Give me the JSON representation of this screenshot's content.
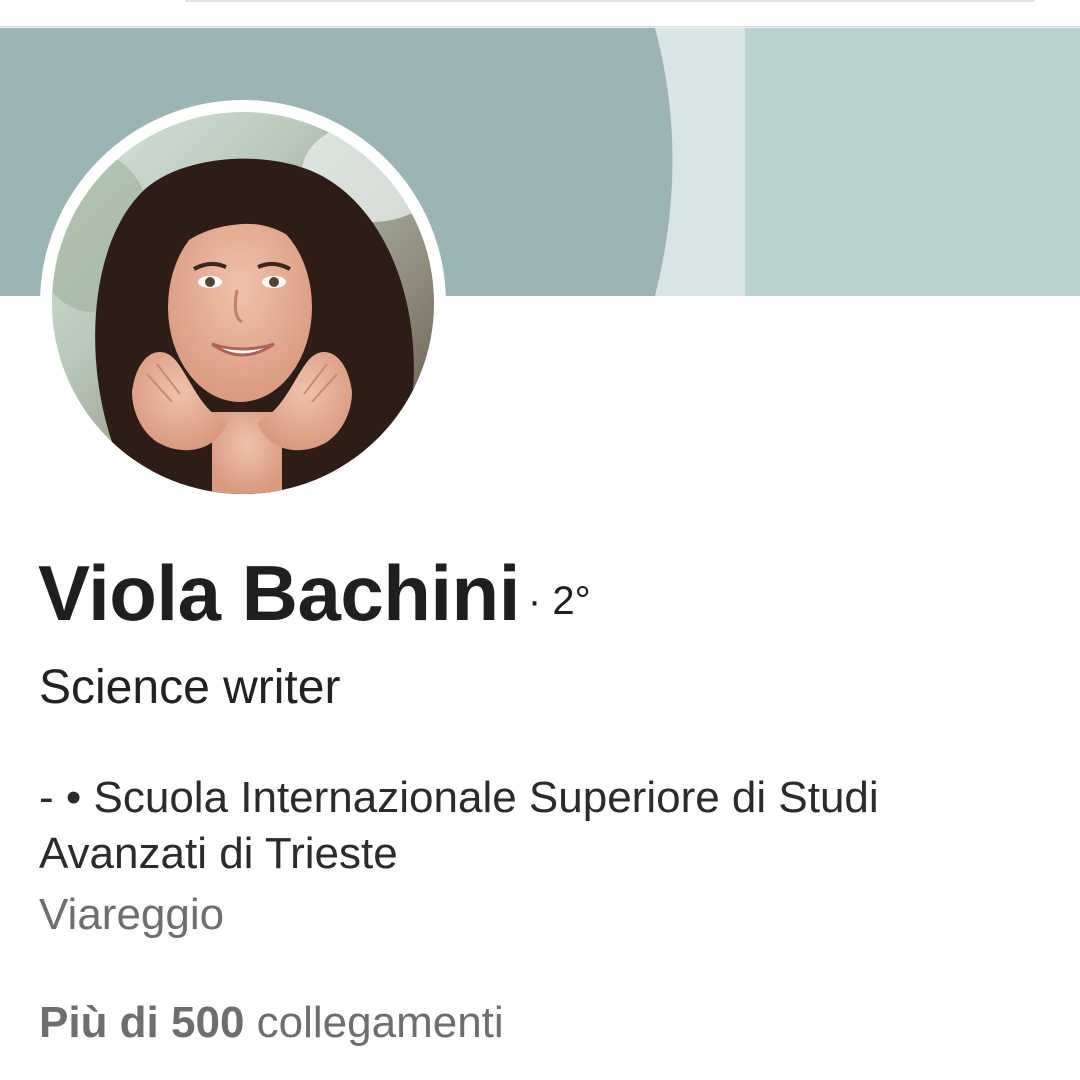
{
  "profile": {
    "name": "Viola Bachini",
    "degree": "· 2°",
    "headline": "Science writer",
    "education": "- • Scuola Internazionale Superiore di Studi Avanzati di Trieste",
    "location": "Viareggio",
    "connections": {
      "count": "Più di 500",
      "label": "collegamenti"
    }
  },
  "colors": {
    "banner_light": "#bdd4d2",
    "banner_dark": "#9db4b4",
    "text_primary": "#1f1f1f",
    "text_secondary": "#6e6e6e"
  }
}
